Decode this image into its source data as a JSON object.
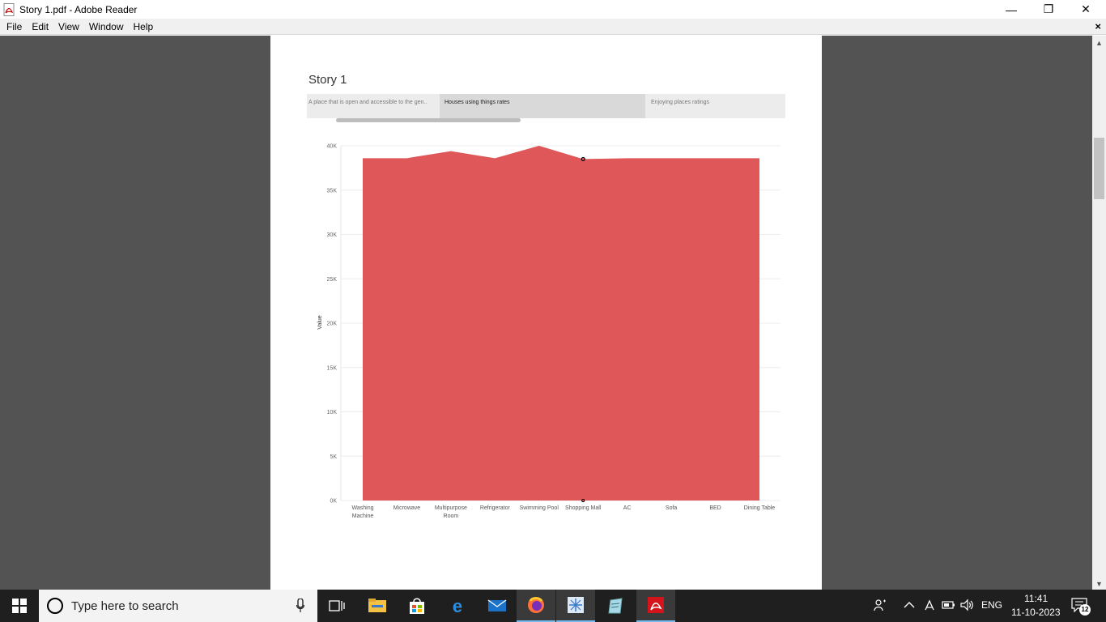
{
  "window": {
    "title": "Story 1.pdf - Adobe Reader",
    "minimize": "—",
    "restore": "❐",
    "close": "✕"
  },
  "menu": [
    "File",
    "Edit",
    "View",
    "Window",
    "Help"
  ],
  "doc_close": "×",
  "story": {
    "title": "Story 1",
    "tabs": [
      {
        "label": "A place that is open and accessible to the gen.."
      },
      {
        "label": "Houses using things rates"
      },
      {
        "label": "Enjoying places ratings"
      }
    ]
  },
  "chart_data": {
    "type": "area",
    "categories": [
      "Washing Machine",
      "Microwave",
      "Multipurpose Room",
      "Refrigerator",
      "Swimming Pool",
      "Shopping Mall",
      "AC",
      "Sofa",
      "BED",
      "Dining Table"
    ],
    "category_lines": [
      [
        "Washing",
        "Machine"
      ],
      [
        "Microwave"
      ],
      [
        "Multipurpose",
        "Room"
      ],
      [
        "Refrigerator"
      ],
      [
        "Swimming Pool"
      ],
      [
        "Shopping Mall"
      ],
      [
        "AC"
      ],
      [
        "Sofa"
      ],
      [
        "BED"
      ],
      [
        "Dining Table"
      ]
    ],
    "values": [
      38600,
      38600,
      39400,
      38600,
      40000,
      38500,
      38600,
      38600,
      38600,
      38600
    ],
    "ylabel": "Value",
    "ylim": [
      0,
      40000
    ],
    "yticks": [
      0,
      5000,
      10000,
      15000,
      20000,
      25000,
      30000,
      35000,
      40000
    ],
    "ytick_labels": [
      "0K",
      "5K",
      "10K",
      "15K",
      "20K",
      "25K",
      "30K",
      "35K",
      "40K"
    ],
    "color": "#e05759",
    "grid": true,
    "highlight_index": 5
  },
  "taskbar": {
    "search_placeholder": "Type here to search",
    "apps": [
      "task-view-icon",
      "file-explorer-icon",
      "store-icon",
      "edge-icon",
      "mail-icon",
      "firefox-icon",
      "snipping-icon",
      "notepad-icon",
      "adobe-reader-icon"
    ],
    "lang": "ENG",
    "time": "11:41",
    "date": "11-10-2023",
    "notifications": "12"
  }
}
